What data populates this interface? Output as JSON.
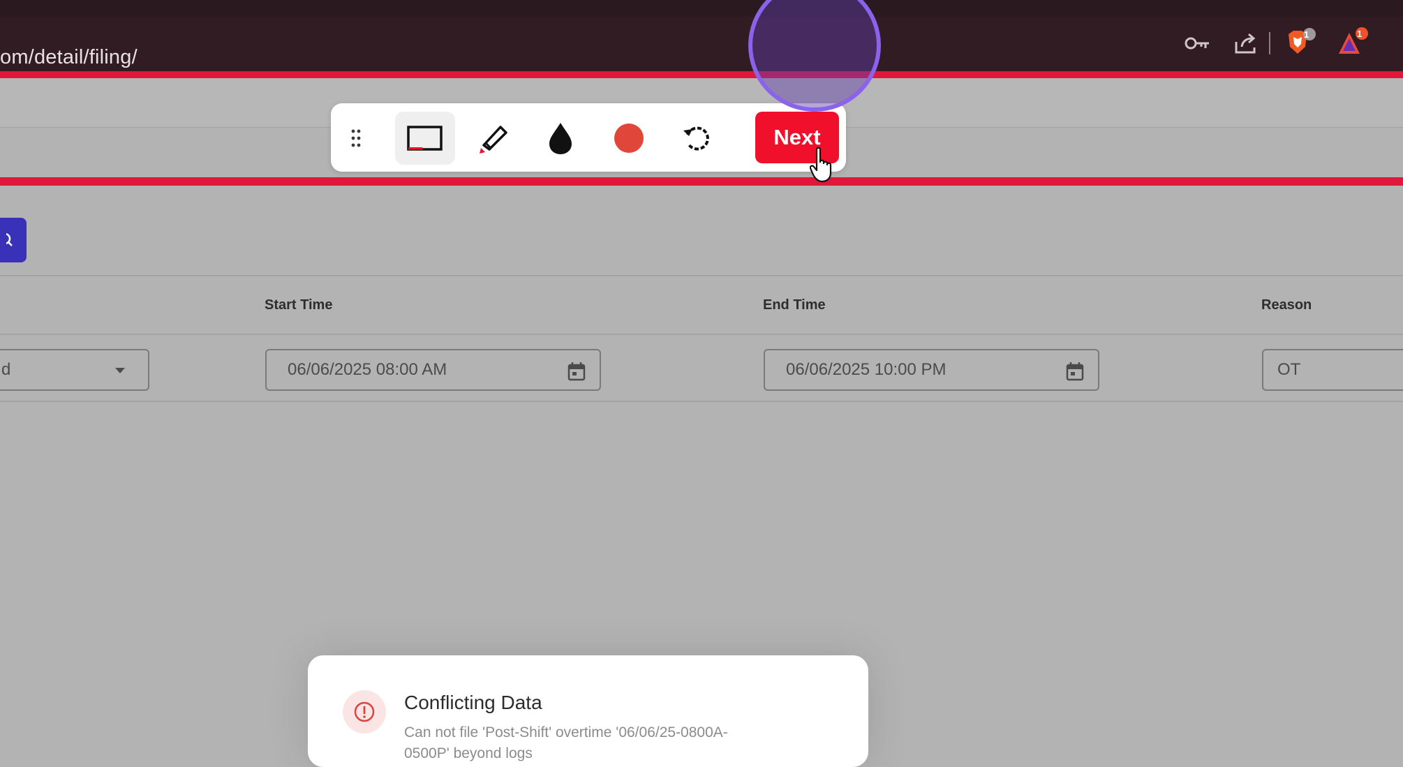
{
  "browser": {
    "url_partial": "om/detail/filing/",
    "shields_badge": "1",
    "rewards_badge": "1"
  },
  "toolbar": {
    "next_label": "Next",
    "record_color": "#e0473a",
    "accent_color": "#f0102c"
  },
  "table": {
    "headers": {
      "start_time": "Start Time",
      "end_time": "End Time",
      "reason": "Reason"
    },
    "row": {
      "select_value_partial": "d",
      "start_time": "06/06/2025 08:00 AM",
      "end_time": "06/06/2025 10:00 PM",
      "reason": "OT"
    }
  },
  "toast": {
    "title": "Conflicting Data",
    "message": "Can not file 'Post-Shift' overtime '06/06/25-0800A-0500P' beyond logs"
  }
}
